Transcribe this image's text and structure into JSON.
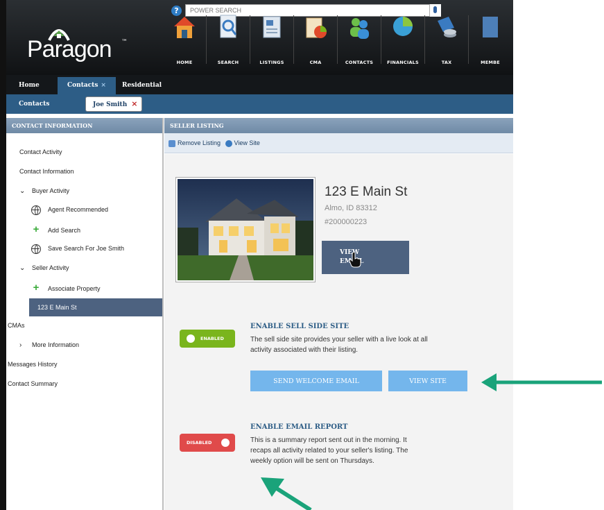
{
  "search": {
    "placeholder": "POWER SEARCH",
    "help": "?"
  },
  "logo": {
    "text": "Paragon",
    "tm": "™"
  },
  "nav": [
    {
      "label": "HOME",
      "icon": "home-icon"
    },
    {
      "label": "SEARCH",
      "icon": "search-document-icon"
    },
    {
      "label": "LISTINGS",
      "icon": "listings-icon"
    },
    {
      "label": "CMA",
      "icon": "cma-icon"
    },
    {
      "label": "CONTACTS",
      "icon": "contacts-icon"
    },
    {
      "label": "FINANCIALS",
      "icon": "pie-chart-icon"
    },
    {
      "label": "TAX",
      "icon": "tax-icon"
    },
    {
      "label": "MEMBE",
      "icon": "member-icon"
    }
  ],
  "tabs": {
    "home": "Home",
    "contacts": "Contacts",
    "contacts_close": "×",
    "residential": "Residential"
  },
  "subbar": {
    "label": "Contacts",
    "chip": "Joe Smith",
    "chip_close": "×"
  },
  "sidebar": {
    "header": "CONTACT INFORMATION",
    "items": [
      {
        "label": "Contact Activity"
      },
      {
        "label": "Contact Information"
      },
      {
        "label": "Buyer Activity",
        "chevron": "⌄"
      },
      {
        "label": "Agent Recommended"
      },
      {
        "label": "Add Search"
      },
      {
        "label": "Save Search For Joe Smith"
      },
      {
        "label": "Seller Activity",
        "chevron": "⌄"
      },
      {
        "label": "Associate Property"
      },
      {
        "label": "123 E Main St"
      },
      {
        "label": "CMAs"
      },
      {
        "label": "More Information",
        "chevron": "›"
      },
      {
        "label": "Messages History"
      },
      {
        "label": "Contact Summary"
      }
    ]
  },
  "main": {
    "header": "SELLER LISTING",
    "toolbar": {
      "remove": "Remove Listing",
      "view_site": "View Site"
    },
    "listing": {
      "address": "123 E Main St",
      "city": "Almo, ID 83312",
      "mls": "#200000223",
      "view_email": "VIEW EMAIL",
      "view_email_line1": "VIEW",
      "view_email_line2": "EMAIL"
    },
    "sell_side": {
      "toggle": "ENABLED",
      "title": "ENABLE SELL SIDE SITE",
      "desc_line1": "The sell side site provides your seller with a live look at all",
      "desc_line2": "activity associated with their listing.",
      "send_welcome": "SEND WELCOME EMAIL",
      "view_site": "VIEW SITE"
    },
    "email_report": {
      "toggle": "DISABLED",
      "title": "ENABLE EMAIL REPORT",
      "desc_line1": "This is a summary report sent out in the morning. It",
      "desc_line2": "recaps all activity related to your seller's listing. The",
      "desc_line3": "weekly option will be sent on Thursdays."
    }
  },
  "colors": {
    "accent": "#2d5d86",
    "enabled": "#7ab51d",
    "disabled": "#e04a4a",
    "button_light": "#74b6ec",
    "arrow": "#1aa37a"
  }
}
